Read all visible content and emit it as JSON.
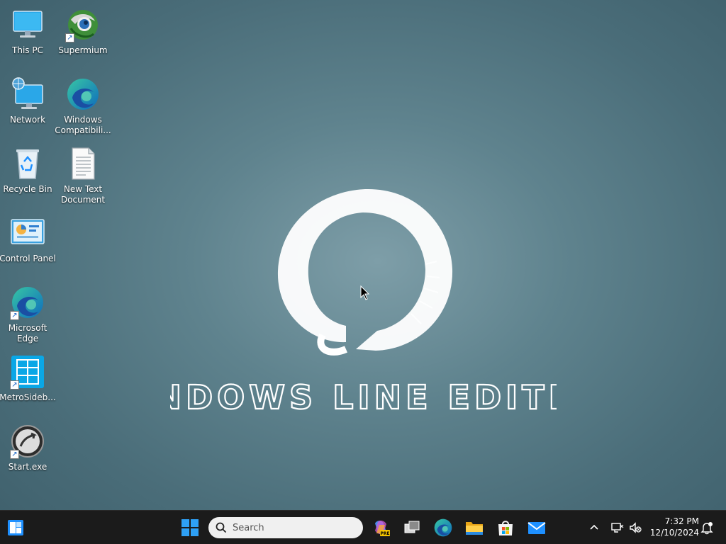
{
  "desktop": {
    "icons": [
      {
        "label": "This PC",
        "icon": "computer-icon"
      },
      {
        "label": "Supermium",
        "icon": "supermium-browser-icon",
        "shortcut": true
      },
      {
        "label": "Network",
        "icon": "network-icon"
      },
      {
        "label": "Windows Compatibili...",
        "icon": "edge-icon"
      },
      {
        "label": "Recycle Bin",
        "icon": "recycle-bin-icon"
      },
      {
        "label": "New Text Document",
        "icon": "text-document-icon"
      },
      {
        "label": "Control Panel",
        "icon": "control-panel-icon"
      },
      {
        "label": "Microsoft Edge",
        "icon": "edge-icon",
        "shortcut": true
      },
      {
        "label": "MetroSideb...",
        "icon": "metro-sidebar-icon",
        "shortcut": true
      },
      {
        "label": "Start.exe",
        "icon": "start-exe-icon",
        "shortcut": true
      }
    ]
  },
  "wallpaper": {
    "text": "WINDOWS LINE EDITION"
  },
  "taskbar": {
    "search_placeholder": "Search",
    "pinned": [
      "copilot-icon",
      "task-view-icon",
      "edge-icon",
      "file-explorer-icon",
      "microsoft-store-icon",
      "mail-icon"
    ],
    "clock": {
      "time": "7:32 PM",
      "date": "12/10/2024"
    }
  },
  "colors": {
    "taskbar_bg": "#1b1b1b",
    "accent_blue": "#1e90ff",
    "wallpaper_center": "#7e9ea8",
    "wallpaper_edge": "#3e5f6b"
  }
}
